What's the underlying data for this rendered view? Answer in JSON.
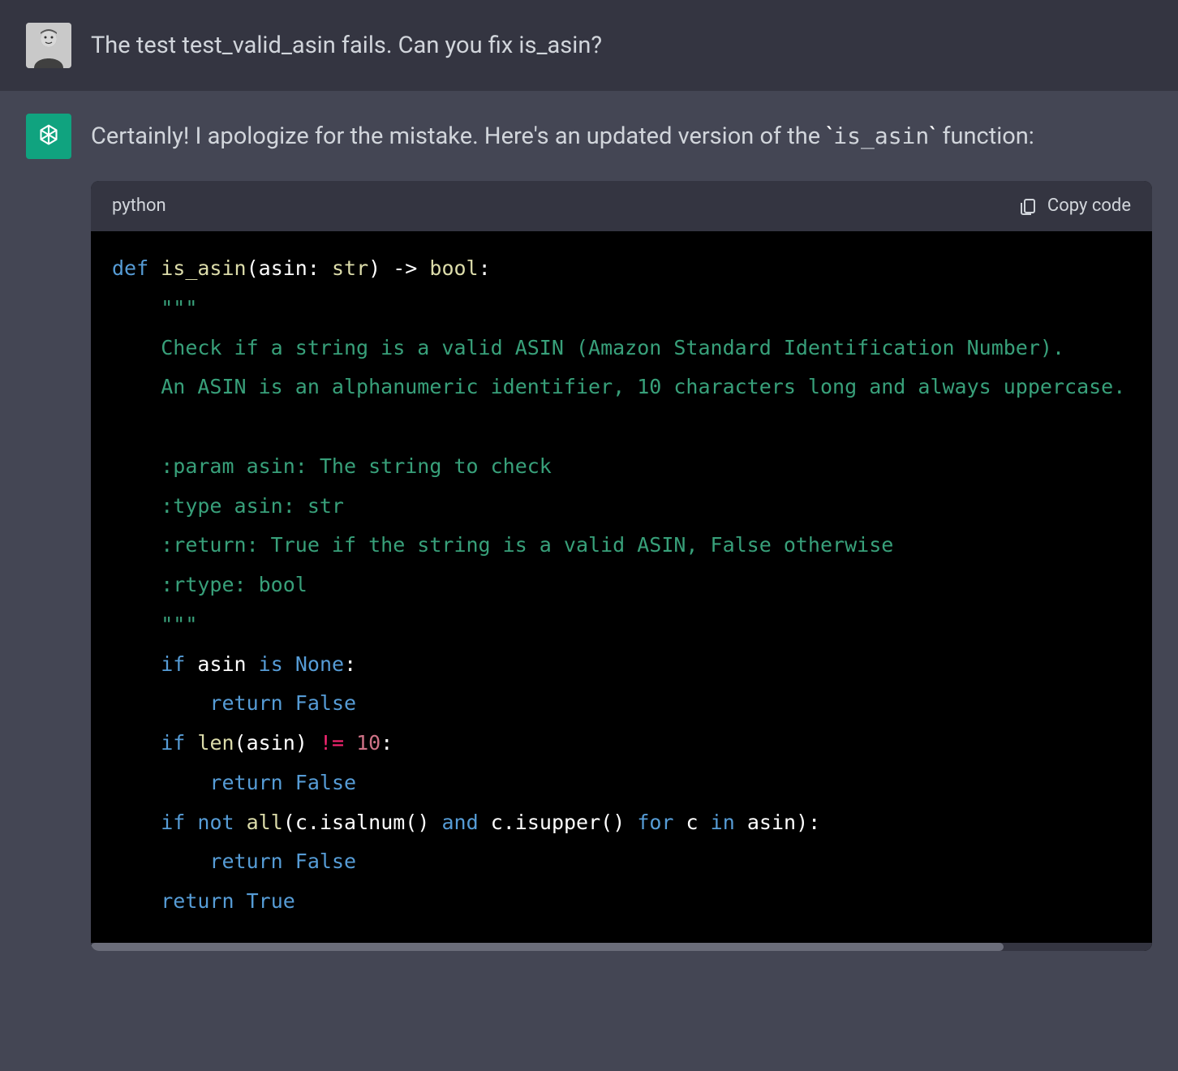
{
  "user_message": {
    "text": "The test test_valid_asin fails. Can you fix is_asin?"
  },
  "assistant_message": {
    "intro_before_code": "Certainly! I apologize for the mistake. Here's an updated version of the ",
    "inline_code": "is_asin",
    "intro_after_code": " function:"
  },
  "code_block": {
    "language_label": "python",
    "copy_label": "Copy code",
    "tokens": {
      "def": "def",
      "fn_name": "is_asin",
      "open_paren": "(",
      "param_name": "asin",
      "colon_type": ": ",
      "type_str": "str",
      "close_paren_arrow": ") -> ",
      "ret_type": "bool",
      "sig_colon": ":",
      "doc_open": "\"\"\"",
      "doc_l1": "Check if a string is a valid ASIN (Amazon Standard Identification Number).",
      "doc_l2": "An ASIN is an alphanumeric identifier, 10 characters long and always uppercase.",
      "doc_blank": "",
      "doc_l3": ":param asin: The string to check",
      "doc_l4": ":type asin: str",
      "doc_l5": ":return: True if the string is a valid ASIN, False otherwise",
      "doc_l6": ":rtype: bool",
      "doc_close": "\"\"\"",
      "if": "if",
      "asin": "asin",
      "is": "is",
      "none": "None",
      "colon": ":",
      "return": "return",
      "false": "False",
      "true": "True",
      "len": "len",
      "neq": "!=",
      "ten": "10",
      "not": "not",
      "all": "all",
      "c": "c",
      "isalnum": ".isalnum()",
      "and": "and",
      "isupper": ".isupper()",
      "for": "for",
      "in": "in",
      "close_paren_colon": "):"
    }
  }
}
